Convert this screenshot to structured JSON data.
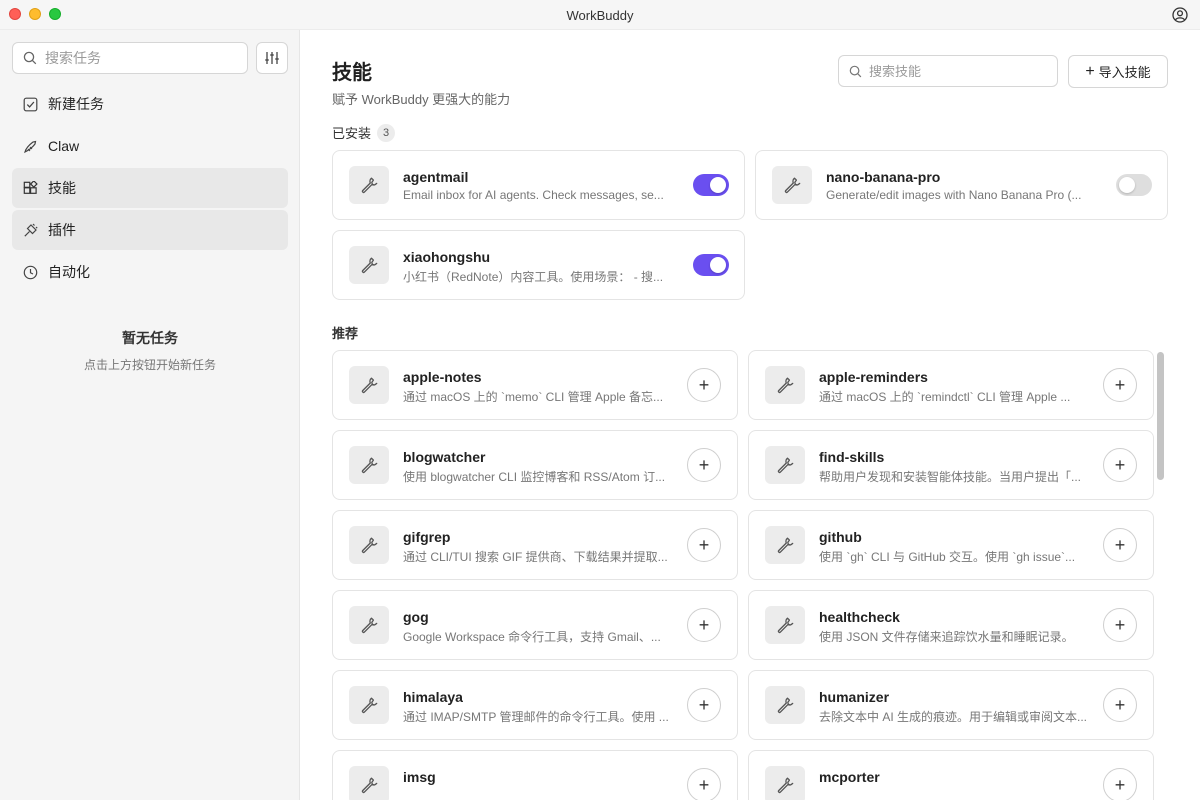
{
  "window": {
    "title": "WorkBuddy"
  },
  "sidebar": {
    "search_placeholder": "搜索任务",
    "items": [
      {
        "label": "新建任务",
        "icon": "new-task-icon"
      },
      {
        "label": "Claw",
        "icon": "claw-icon"
      },
      {
        "label": "技能",
        "icon": "skills-icon",
        "active": true
      },
      {
        "label": "插件",
        "icon": "plugin-icon"
      },
      {
        "label": "自动化",
        "icon": "clock-icon"
      }
    ],
    "empty_title": "暂无任务",
    "empty_sub": "点击上方按钮开始新任务"
  },
  "main": {
    "title": "技能",
    "subtitle": "赋予 WorkBuddy 更强大的能力",
    "search_placeholder": "搜索技能",
    "import_label": "导入技能",
    "installed_label": "已安装",
    "installed_count": "3",
    "recommended_label": "推荐",
    "installed": [
      {
        "name": "agentmail",
        "desc": "Email inbox for AI agents. Check messages, se...",
        "enabled": true
      },
      {
        "name": "nano-banana-pro",
        "desc": "Generate/edit images with Nano Banana Pro (...",
        "enabled": false
      },
      {
        "name": "xiaohongshu",
        "desc": "小红书（RedNote）内容工具。使用场景： - 搜...",
        "enabled": true
      }
    ],
    "recommended": [
      {
        "name": "apple-notes",
        "desc": "通过 macOS 上的 `memo` CLI 管理 Apple 备忘..."
      },
      {
        "name": "apple-reminders",
        "desc": "通过 macOS 上的 `remindctl` CLI 管理 Apple ..."
      },
      {
        "name": "blogwatcher",
        "desc": "使用 blogwatcher CLI 监控博客和 RSS/Atom 订..."
      },
      {
        "name": "find-skills",
        "desc": "帮助用户发现和安装智能体技能。当用户提出「..."
      },
      {
        "name": "gifgrep",
        "desc": "通过 CLI/TUI 搜索 GIF 提供商、下载结果并提取..."
      },
      {
        "name": "github",
        "desc": "使用 `gh` CLI 与 GitHub 交互。使用 `gh issue`..."
      },
      {
        "name": "gog",
        "desc": "Google Workspace 命令行工具，支持 Gmail、..."
      },
      {
        "name": "healthcheck",
        "desc": "使用 JSON 文件存储来追踪饮水量和睡眠记录。"
      },
      {
        "name": "himalaya",
        "desc": "通过 IMAP/SMTP 管理邮件的命令行工具。使用 ..."
      },
      {
        "name": "humanizer",
        "desc": "去除文本中 AI 生成的痕迹。用于编辑或审阅文本..."
      },
      {
        "name": "imsg",
        "desc": ""
      },
      {
        "name": "mcporter",
        "desc": ""
      }
    ]
  },
  "colors": {
    "accent": "#6a4ff0",
    "toggle_off": "#dedede"
  }
}
